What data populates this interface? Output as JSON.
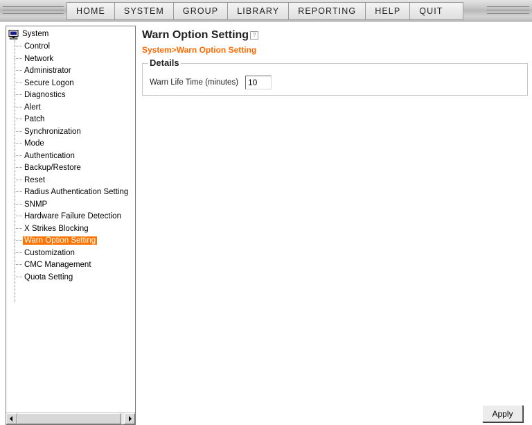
{
  "menu": {
    "items": [
      {
        "label": "HOME"
      },
      {
        "label": "SYSTEM"
      },
      {
        "label": "GROUP"
      },
      {
        "label": "LIBRARY"
      },
      {
        "label": "REPORTING"
      },
      {
        "label": "HELP"
      },
      {
        "label": "QUIT"
      }
    ]
  },
  "tree": {
    "root_label": "System",
    "root_icon": "monitor-icon",
    "items": [
      {
        "label": "Control"
      },
      {
        "label": "Network"
      },
      {
        "label": "Administrator"
      },
      {
        "label": "Secure Logon"
      },
      {
        "label": "Diagnostics"
      },
      {
        "label": "Alert"
      },
      {
        "label": "Patch"
      },
      {
        "label": "Synchronization"
      },
      {
        "label": "Mode"
      },
      {
        "label": "Authentication"
      },
      {
        "label": "Backup/Restore"
      },
      {
        "label": "Reset"
      },
      {
        "label": "Radius Authentication Setting"
      },
      {
        "label": "SNMP"
      },
      {
        "label": "Hardware Failure Detection"
      },
      {
        "label": "X Strikes Blocking"
      },
      {
        "label": "Warn Option Setting"
      },
      {
        "label": "Customization"
      },
      {
        "label": "CMC Management"
      },
      {
        "label": "Quota Setting"
      }
    ],
    "selected_label": "Warn Option Setting",
    "selected_color": "#ff7300"
  },
  "main": {
    "title": "Warn Option Setting",
    "breadcrumb": "System>Warn Option Setting",
    "breadcrumb_color": "#ff6a00",
    "details": {
      "legend": "Details",
      "warn_life_label": "Warn Life Time (minutes)",
      "warn_life_value": "10"
    },
    "apply_label": "Apply"
  }
}
